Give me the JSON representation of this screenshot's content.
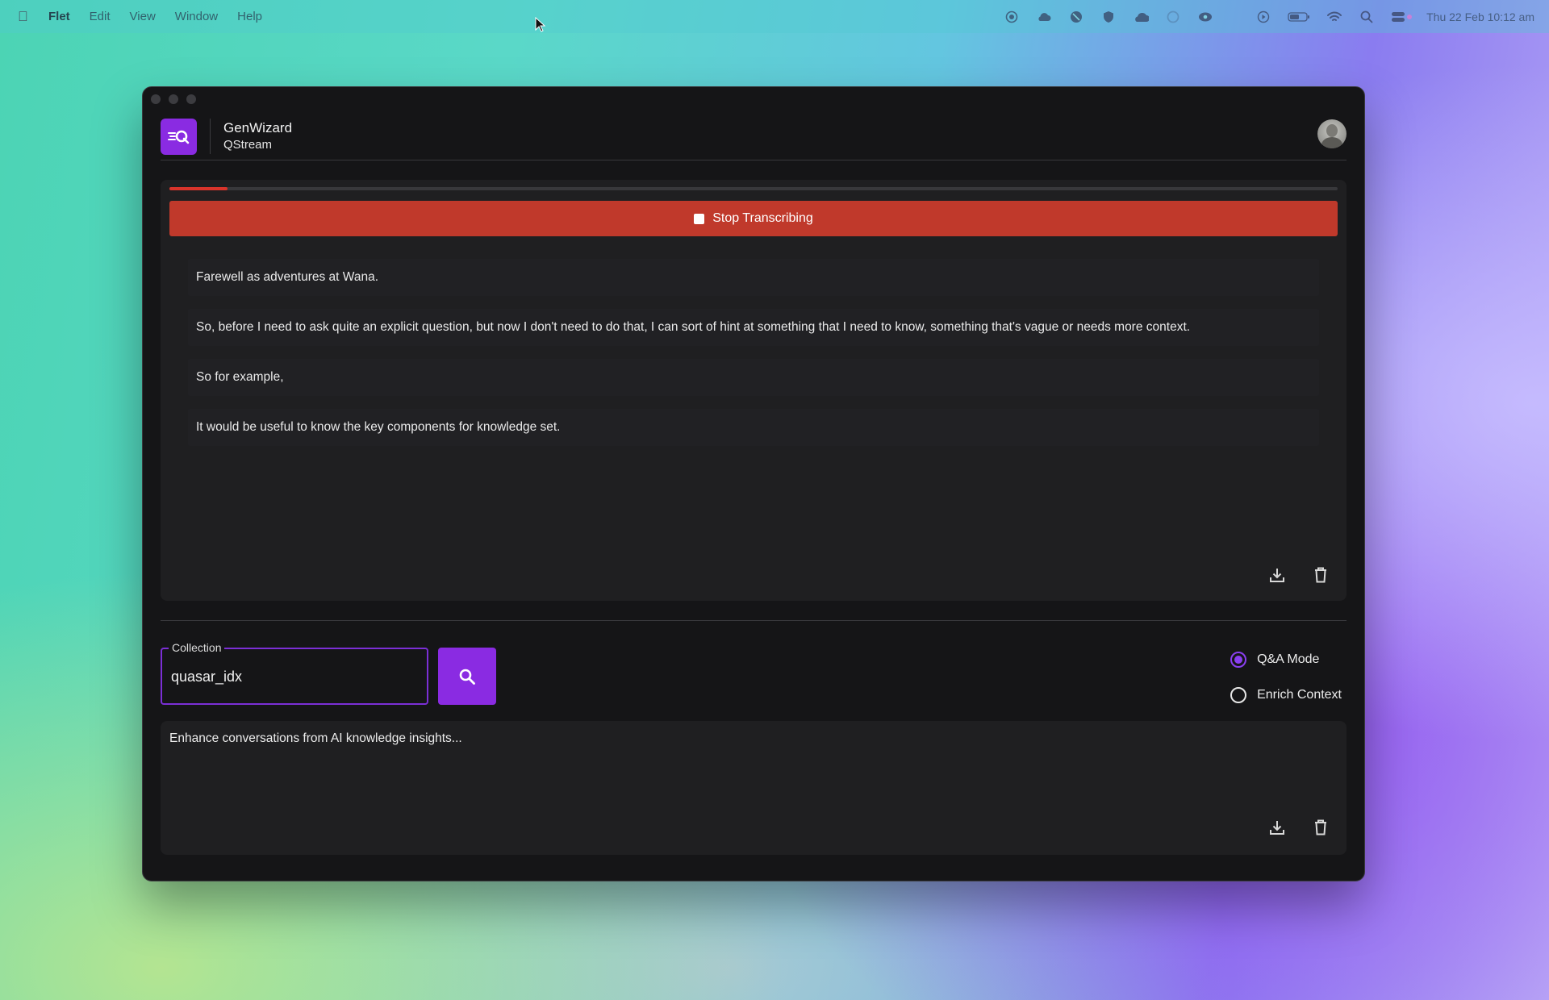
{
  "menubar": {
    "app": "Flet",
    "items": [
      "Edit",
      "View",
      "Window",
      "Help"
    ],
    "clock": "Thu 22 Feb  10:12 am",
    "status_icons": [
      "record-icon",
      "cloud-sync-icon",
      "vpn-icon",
      "shield-icon",
      "cloud-icon",
      "app-icon",
      "eye-icon",
      "play-icon",
      "battery-icon",
      "wifi-icon",
      "search-icon",
      "control-center-icon"
    ]
  },
  "header": {
    "title": "GenWizard",
    "subtitle": "QStream"
  },
  "transcription": {
    "progress": 0.05,
    "stop_label": "Stop Transcribing",
    "lines": [
      "Farewell as adventures at Wana.",
      "So, before I need to ask quite an explicit question, but now I don't need to do that, I can sort of hint at something that I need to know, something that's vague or needs more context.",
      "So for example,",
      "It would be useful to know the key components for knowledge set."
    ]
  },
  "collection": {
    "label": "Collection",
    "value": "quasar_idx"
  },
  "modes": {
    "options": [
      "Q&A Mode",
      "Enrich Context"
    ],
    "selected": "Q&A Mode"
  },
  "insights": {
    "text": "Enhance conversations from AI knowledge insights..."
  },
  "colors": {
    "accent": "#8a2be2",
    "stop_button": "#c0392b",
    "progress": "#d9342b",
    "window_bg": "#151517",
    "panel_bg": "#1f1f21"
  }
}
